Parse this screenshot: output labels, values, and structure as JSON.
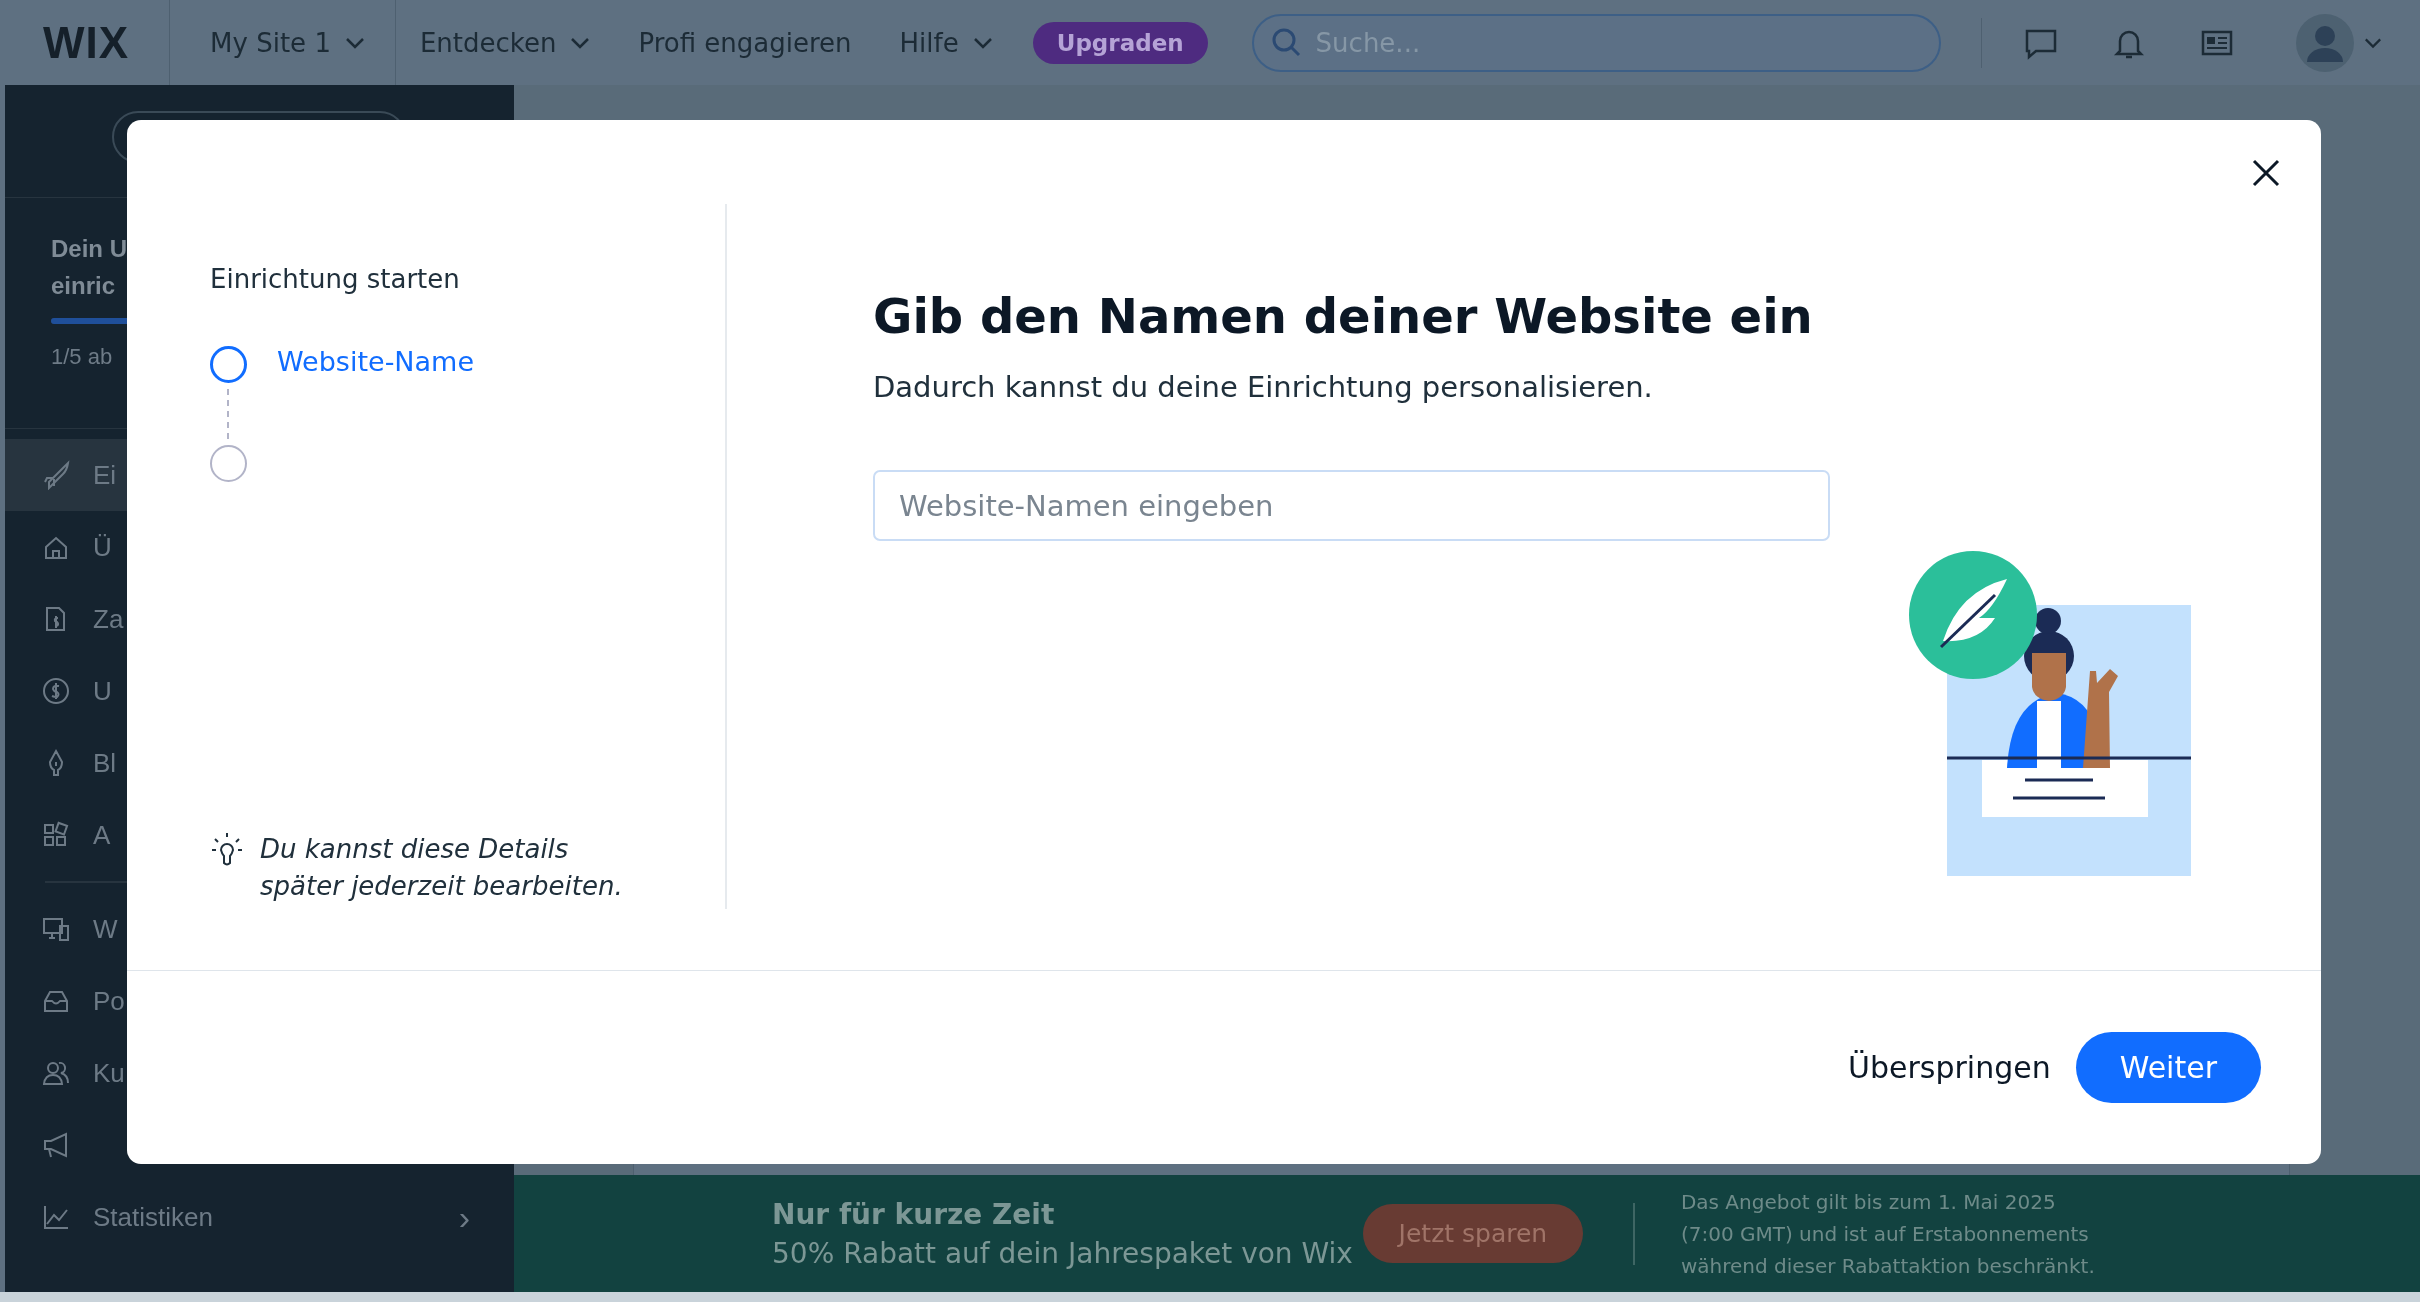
{
  "topbar": {
    "logo": "WIX",
    "site": "My Site 1",
    "nav": [
      {
        "label": "Entdecken",
        "dropdown": true
      },
      {
        "label": "Profi engagieren",
        "dropdown": false
      },
      {
        "label": "Hilfe",
        "dropdown": true
      }
    ],
    "upgrade": "Upgraden",
    "search": {
      "placeholder": "Suche..."
    }
  },
  "sidebar": {
    "header_lines": [
      "Dein U",
      "einric"
    ],
    "progress": {
      "level": 0.2
    },
    "progress_text": "1/5 ab",
    "sections": [
      [
        {
          "label": "Ei",
          "selected": true
        },
        {
          "label": "Ü",
          "selected": false
        },
        {
          "label": "Za",
          "selected": false
        },
        {
          "label": "U",
          "selected": false
        },
        {
          "label": "Bl",
          "selected": false
        },
        {
          "label": "A",
          "selected": false
        }
      ],
      [
        {
          "label": "W",
          "selected": false
        },
        {
          "label": "Po",
          "selected": false
        },
        {
          "label": "Ku",
          "selected": false
        },
        {
          "selected": false
        },
        {
          "label": "Statistiken",
          "selected": false,
          "arrow": "›"
        }
      ]
    ]
  },
  "banner": {
    "title": "Nur für kurze Zeit",
    "text": "50% Rabatt auf dein Jahrespaket von Wix",
    "button": "Jetzt sparen",
    "note": "Das Angebot gilt bis zum 1. Mai 2025 (7:00 GMT) und ist auf Erstabonnements während dieser Rabattaktion beschränkt."
  },
  "modal": {
    "steps_title": "Einrichtung starten",
    "steps": [
      {
        "label": "Website-Name",
        "selected": true
      },
      {
        "selected": false
      }
    ],
    "tip": "Du kannst diese Details später jederzeit bearbeiten.",
    "title": "Gib den Namen deiner Website ein",
    "subtitle": "Dadurch kannst du deine Einrichtung personalisieren.",
    "input": {
      "placeholder": "Website-Namen eingeben"
    },
    "buttons": [
      {
        "label": "Überspringen",
        "kind": "text"
      },
      {
        "label": "Weiter",
        "kind": "primary"
      }
    ]
  }
}
